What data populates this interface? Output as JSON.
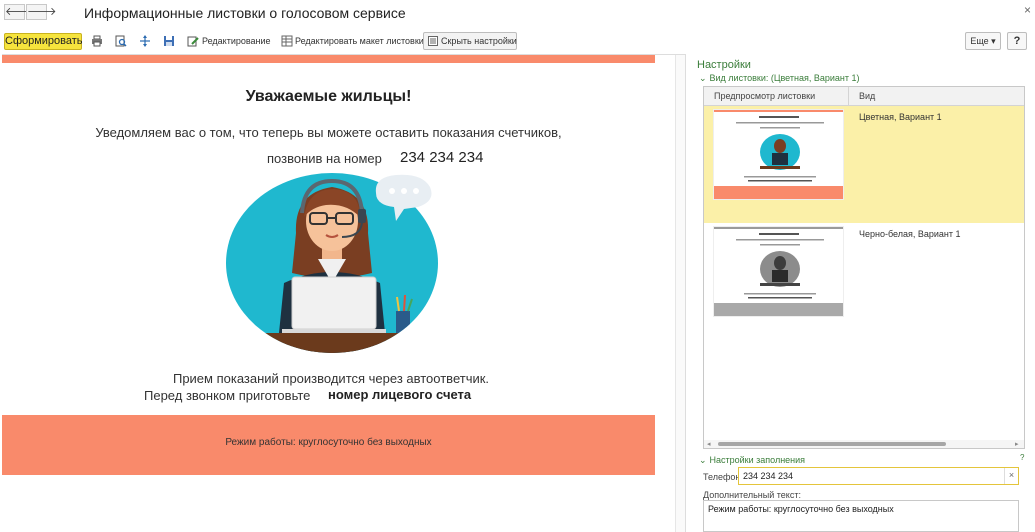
{
  "window": {
    "title": "Информационные листовки о голосовом сервисе",
    "close_glyph": "×",
    "back_icon": "arrow-left-icon",
    "forward_icon": "arrow-right-icon"
  },
  "toolbar": {
    "form_label": "Сформировать",
    "edit_label": "Редактирование",
    "edit_layout_label": "Редактировать макет листовки",
    "hide_settings_label": "Скрыть настройки",
    "more_label": "Еще ▾",
    "help_label": "?",
    "accent_color": "#f6e43d"
  },
  "preview": {
    "greeting": "Уважаемые жильцы!",
    "line1": "Уведомляем вас о том, что теперь вы можете оставить показания счетчиков,",
    "phone_label": "позвонив на номер",
    "phone_number": "234 234 234",
    "line2": "Прием показаний производится через автоответчик.",
    "line3_prefix": "Перед звонком приготовьте",
    "line3_bold": "номер лицевого счета",
    "footer": "Режим работы: круглосуточно без выходных",
    "band_color": "#f98a6b"
  },
  "settings": {
    "title": "Настройки",
    "section_type": "Вид листовки: (Цветная, Вариант 1)",
    "table": {
      "col_preview": "Предпросмотр листовки",
      "col_type": "Вид",
      "rows": [
        {
          "label": "Цветная, Вариант 1",
          "selected": true
        },
        {
          "label": "Черно-белая, Вариант 1",
          "selected": false
        }
      ]
    },
    "section_fill": "Настройки заполнения",
    "help_glyph": "?",
    "phone_label": "Телефон:",
    "phone_value": "234 234 234",
    "clear_glyph": "×",
    "extra_label": "Дополнительный текст:",
    "extra_value": "Режим работы: круглосуточно без выходных"
  }
}
